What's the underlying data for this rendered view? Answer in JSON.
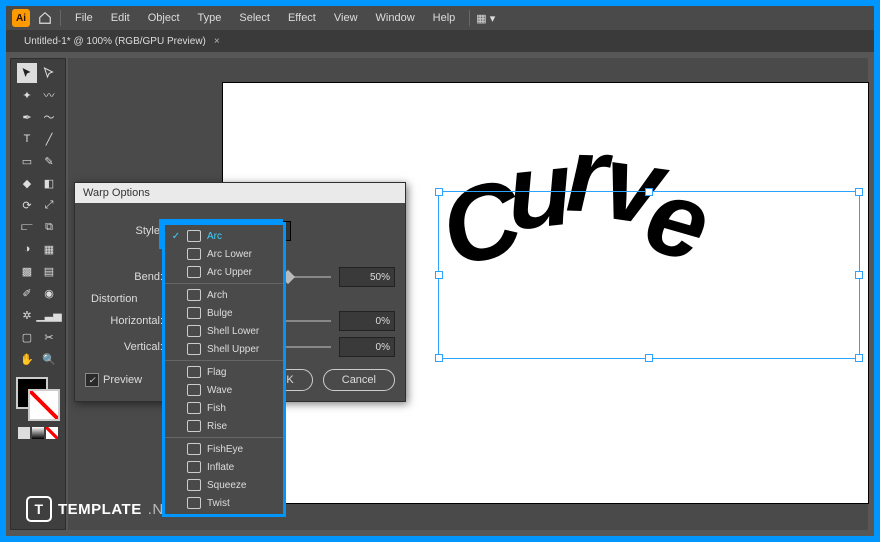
{
  "menu": {
    "items": [
      "File",
      "Edit",
      "Object",
      "Type",
      "Select",
      "Effect",
      "View",
      "Window",
      "Help"
    ]
  },
  "tab": {
    "title": "Untitled-1* @ 100% (RGB/GPU Preview)"
  },
  "dialog": {
    "title": "Warp Options",
    "styleLabel": "Style:",
    "styleValue": "Arc",
    "bendLabel": "Bend:",
    "bendValue": "50%",
    "distortionLabel": "Distortion",
    "horizLabel": "Horizontal:",
    "horizValue": "0%",
    "vertLabel": "Vertical:",
    "vertValue": "0%",
    "previewLabel": "Preview",
    "okLabel": "OK",
    "cancelLabel": "Cancel"
  },
  "dropdown": {
    "selected": "Arc",
    "groups": [
      [
        "Arc",
        "Arc Lower",
        "Arc Upper"
      ],
      [
        "Arch",
        "Bulge",
        "Shell Lower",
        "Shell Upper"
      ],
      [
        "Flag",
        "Wave",
        "Fish",
        "Rise"
      ],
      [
        "FishEye",
        "Inflate",
        "Squeeze",
        "Twist"
      ]
    ]
  },
  "canvasText": "Curve",
  "watermark": {
    "brand": "TEMPLATE",
    "suffix": ".NET"
  }
}
